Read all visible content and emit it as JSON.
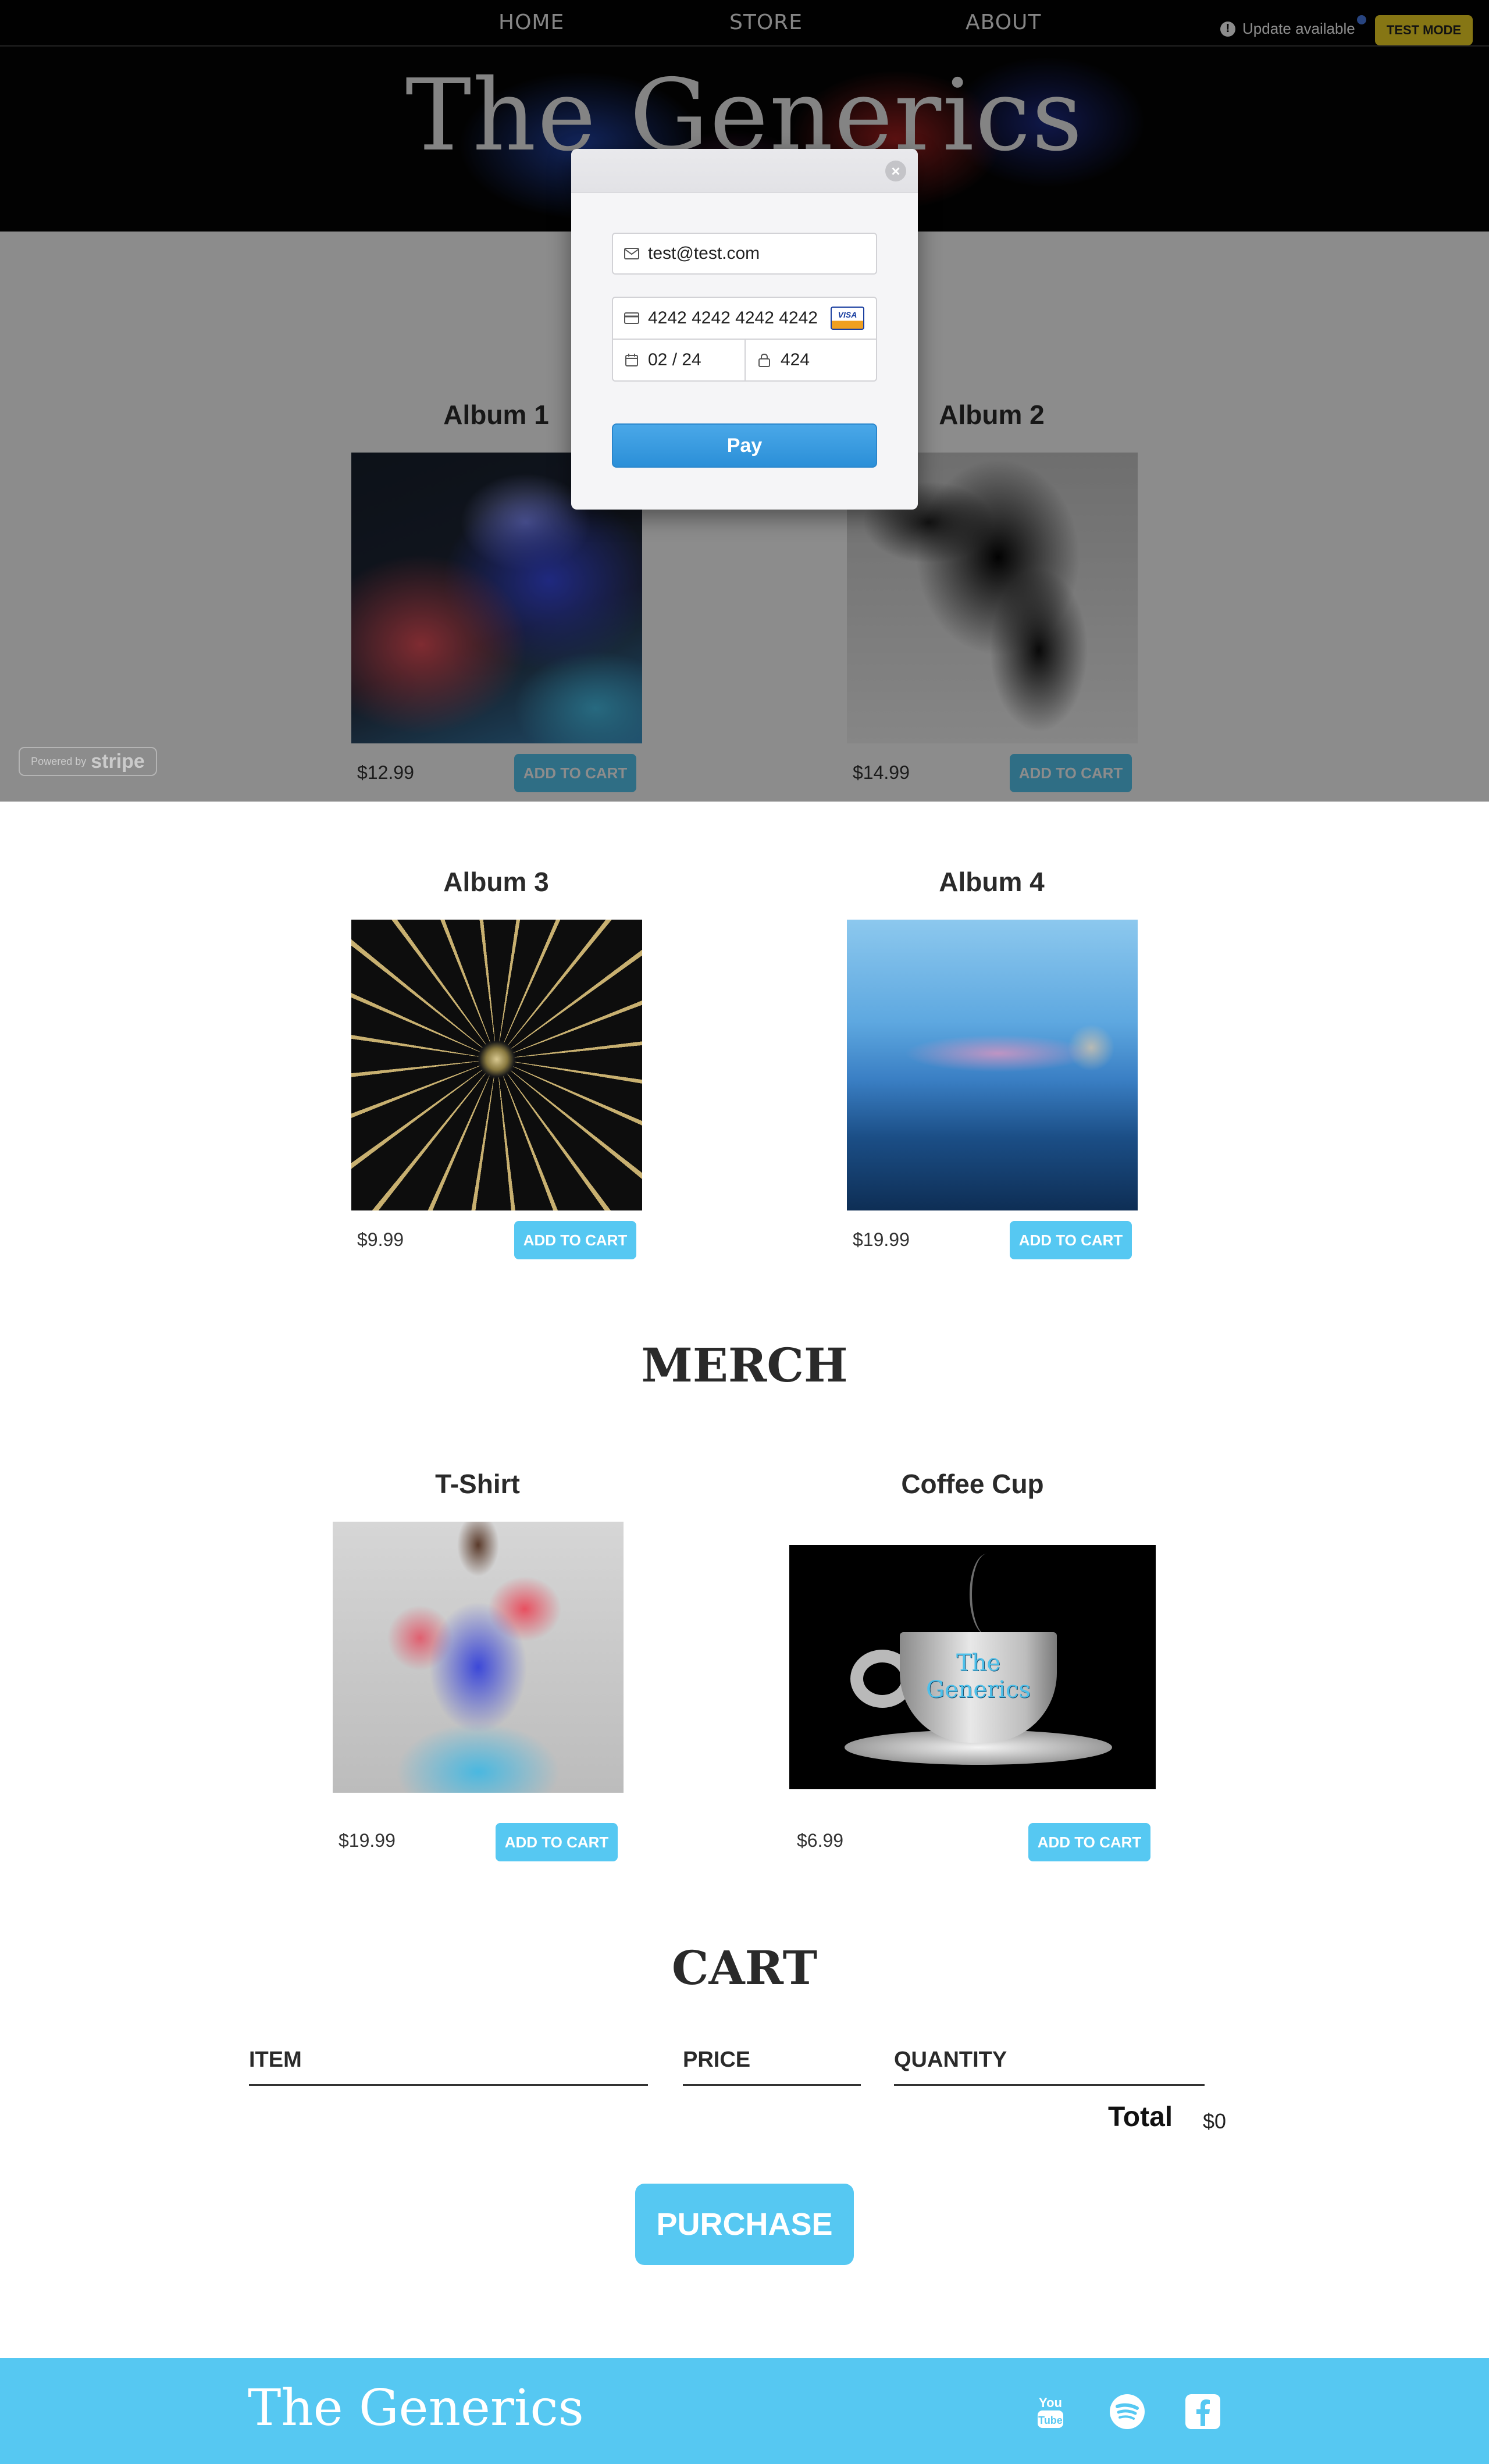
{
  "nav": {
    "links": [
      "HOME",
      "STORE",
      "ABOUT"
    ]
  },
  "notice": {
    "update_label": "Update available",
    "test_mode_label": "TEST MODE"
  },
  "header": {
    "band_name": "The Generics"
  },
  "music": {
    "albums": [
      {
        "title": "Album 1",
        "price": "$12.99",
        "button": "ADD TO CART"
      },
      {
        "title": "Album 2",
        "price": "$14.99",
        "button": "ADD TO CART"
      },
      {
        "title": "Album 3",
        "price": "$9.99",
        "button": "ADD TO CART"
      },
      {
        "title": "Album 4",
        "price": "$19.99",
        "button": "ADD TO CART"
      }
    ]
  },
  "merch": {
    "title": "MERCH",
    "items": [
      {
        "title": "T-Shirt",
        "price": "$19.99",
        "button": "ADD TO CART"
      },
      {
        "title": "Coffee Cup",
        "price": "$6.99",
        "button": "ADD TO CART",
        "print": "The Generics"
      }
    ]
  },
  "cart": {
    "title": "CART",
    "columns": [
      "ITEM",
      "PRICE",
      "QUANTITY"
    ],
    "total_label": "Total",
    "total_value": "$0",
    "purchase_label": "PURCHASE"
  },
  "footer": {
    "band_name": "The Generics",
    "social_icons": [
      "youtube-icon",
      "spotify-icon",
      "facebook-icon"
    ]
  },
  "stripe_modal": {
    "email": "test@test.com",
    "card_number": "4242 4242 4242 4242",
    "card_brand": "VISA",
    "expiry": "02 / 24",
    "cvc": "424",
    "pay_label": "Pay",
    "close_glyph": "×"
  },
  "stripe_badge": {
    "powered_by": "Powered by",
    "brand": "stripe"
  },
  "colors": {
    "accent": "#56c8f2",
    "test_mode": "#f5d725",
    "pay_button": "#2b8fd8"
  }
}
